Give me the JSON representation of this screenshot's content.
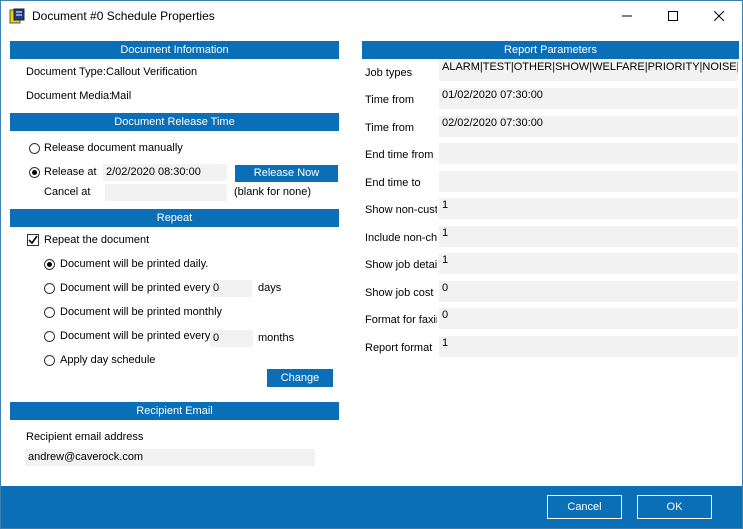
{
  "window": {
    "title": "Document #0 Schedule Properties"
  },
  "doc_info": {
    "header": "Document Information",
    "type_label": "Document Type:",
    "type_value": "Callout Verification",
    "media_label": "Document Media:",
    "media_value": "Mail"
  },
  "release": {
    "header": "Document Release Time",
    "manual_label": "Release document manually",
    "at_label": "Release at",
    "at_value": "2/02/2020 08:30:00",
    "release_now_label": "Release Now",
    "cancel_label": "Cancel at",
    "cancel_value": "",
    "cancel_hint": "(blank for none)"
  },
  "repeat": {
    "header": "Repeat",
    "repeat_label": "Repeat the document",
    "daily_label": "Document will be printed daily.",
    "every_days_label": "Document will be printed every",
    "every_days_value": "0",
    "days_unit": "days",
    "monthly_label": "Document will be printed monthly",
    "every_months_label": "Document will be printed every",
    "every_months_value": "0",
    "months_unit": "months",
    "day_schedule_label": "Apply day schedule",
    "change_label": "Change"
  },
  "email": {
    "header": "Recipient Email",
    "address_label": "Recipient email address",
    "address_value": "andrew@caverock.com"
  },
  "params": {
    "header": "Report Parameters",
    "rows": [
      {
        "label": "Job types",
        "value": "ALARM|TEST|OTHER|SHOW|WELFARE|PRIORITY|NOISE|CASH|"
      },
      {
        "label": "Time from",
        "value": "01/02/2020 07:30:00"
      },
      {
        "label": "Time from",
        "value": "02/02/2020 07:30:00"
      },
      {
        "label": "End time from",
        "value": ""
      },
      {
        "label": "End time to",
        "value": ""
      },
      {
        "label": "Show non-cust",
        "value": "1"
      },
      {
        "label": "Include non-cha",
        "value": "1"
      },
      {
        "label": "Show job detail",
        "value": "1"
      },
      {
        "label": "Show job cost",
        "value": "0"
      },
      {
        "label": "Format for faxin",
        "value": "0"
      },
      {
        "label": "Report format",
        "value": "1"
      }
    ]
  },
  "footer": {
    "cancel_label": "Cancel",
    "ok_label": "OK"
  }
}
